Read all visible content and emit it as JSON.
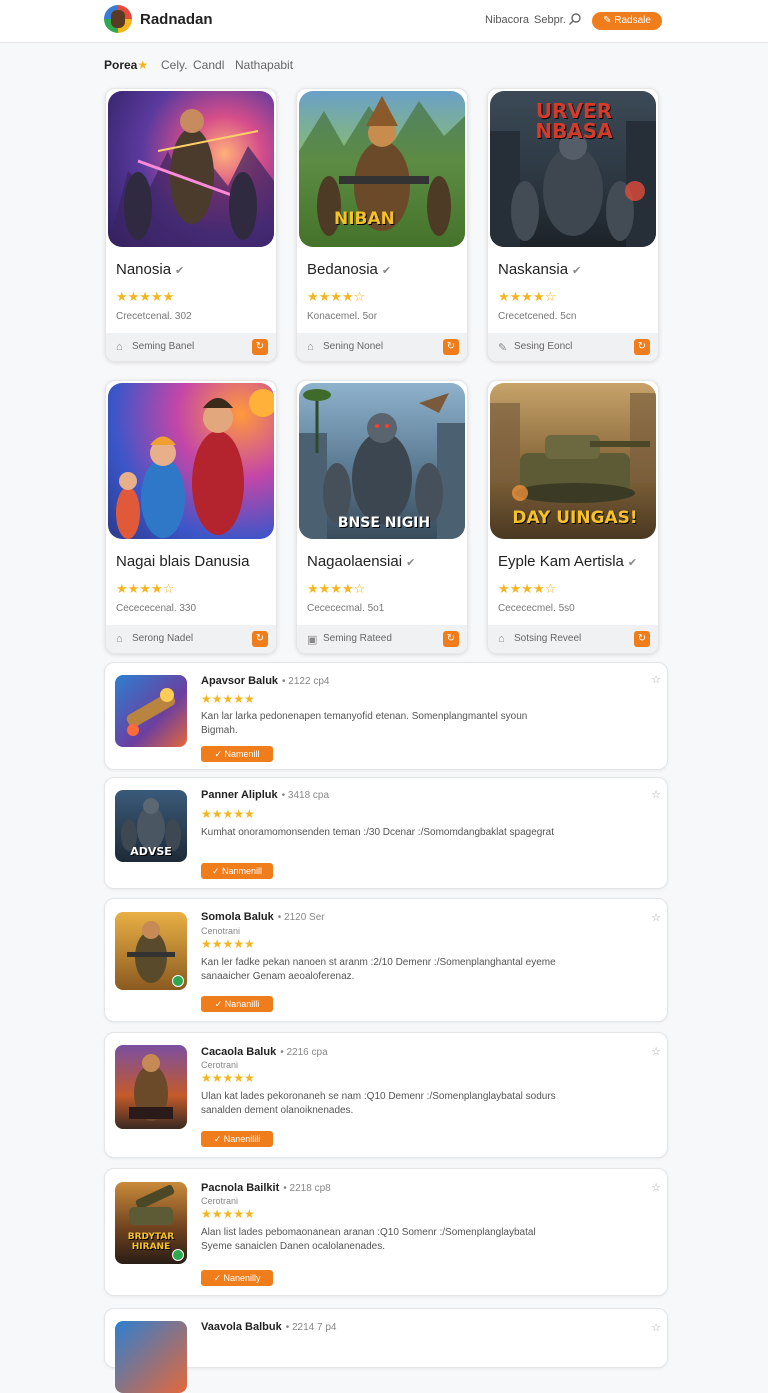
{
  "header": {
    "brand": "Radnadan",
    "nav": [
      "Nibacora",
      "Sebpr."
    ],
    "action_label": "Radsale"
  },
  "filters": [
    "Porea",
    "Cely.",
    "Candl",
    "Nathapabit"
  ],
  "cards": [
    {
      "title": "Nanosia",
      "stars": "★★★★★",
      "rating": 5,
      "meta": "Crecetcenal. 302",
      "footer": "Seming Banel",
      "art_text": ""
    },
    {
      "title": "Bedanosia",
      "stars": "★★★★☆",
      "rating": 4,
      "meta": "Konacemel. 5or",
      "footer": "Sening Nonel",
      "art_text": "NIBAN"
    },
    {
      "title": "Naskansia",
      "stars": "★★★★☆",
      "rating": 4,
      "meta": "Crecetcened. 5cn",
      "footer": "Sesing Eoncl",
      "art_text": "URVER NBASA"
    },
    {
      "title": "Nagai blais Danusia",
      "stars": "★★★★☆",
      "rating": 4,
      "meta": "Cecececenal. 330",
      "footer": "Serong Nadel",
      "art_text": ""
    },
    {
      "title": "Nagaolaensiai",
      "stars": "★★★★☆",
      "rating": 4,
      "meta": "Cecececmal. 5o1",
      "footer": "Seming Rateed",
      "art_text": "BNSE NIGIH"
    },
    {
      "title": "Eyple Kam Aertisla",
      "stars": "★★★★☆",
      "rating": 4,
      "meta": "Cecececmel. 5s0",
      "footer": "Sotsing Reveel",
      "art_text": "DAY UINGAS!"
    }
  ],
  "list": [
    {
      "title": "Apavsor Baluk",
      "meta": "• 2122 cp4",
      "sub": "",
      "stars": "★★★★★",
      "rating": 5,
      "desc": "Kan lar larka pedonenapen temanyofid etenan. Somenplangmantel syoun Bigmah.",
      "button": "✓ Namenill",
      "art_text": "",
      "badge": false
    },
    {
      "title": "Panner Alipluk",
      "meta": "• 3418 cpa",
      "sub": "",
      "stars": "★★★★★",
      "rating": 5,
      "desc": "Kumhat onoramomonsenden teman :/30 Dcenar :/Somomdangbaklat spagegrat",
      "button": "✓ Nanmenill",
      "art_text": "ADVSE",
      "badge": false
    },
    {
      "title": "Somola Baluk",
      "meta": "• 2120 Ser",
      "sub": "Cenotrani",
      "stars": "★★★★★",
      "rating": 5,
      "desc": "Kan ler fadke pekan nanoen st aranm :2/10 Demenr :/Somenplanghantal eyeme sanaaicher Genam aeoaloferenaz.",
      "button": "✓ Nananilli",
      "art_text": "",
      "badge": true
    },
    {
      "title": "Cacaola Baluk",
      "meta": "• 2216 cpa",
      "sub": "Cerotrani",
      "stars": "★★★★★",
      "rating": 5,
      "desc": "Ulan kat lades pekoronaneh se nam :Q10 Demenr :/Somenplanglaybatal sodurs sanalden dement olanoiknenades.",
      "button": "✓ Nanenilili",
      "art_text": "",
      "badge": false
    },
    {
      "title": "Pacnola Bailkit",
      "meta": "• 2218 cp8",
      "sub": "Cerotrani",
      "stars": "★★★★★",
      "rating": 5,
      "desc": "Alan list lades pebomaonanean aranan :Q10 Somenr :/Somenplanglaybatal Syeme sanaiclen Danen ocalolanenades.",
      "button": "✓ Nanenilly",
      "art_text": "BRDYTAR HIRANE",
      "badge": true
    },
    {
      "title": "Vaavola Balbuk",
      "meta": "• 2214 7 p4",
      "sub": "",
      "stars": "",
      "rating": 0,
      "desc": "",
      "button": "",
      "art_text": "",
      "badge": false
    }
  ],
  "colors": {
    "accent": "#f07d1c",
    "star": "#f5b51d",
    "verified_badge": "#2fa84f"
  }
}
